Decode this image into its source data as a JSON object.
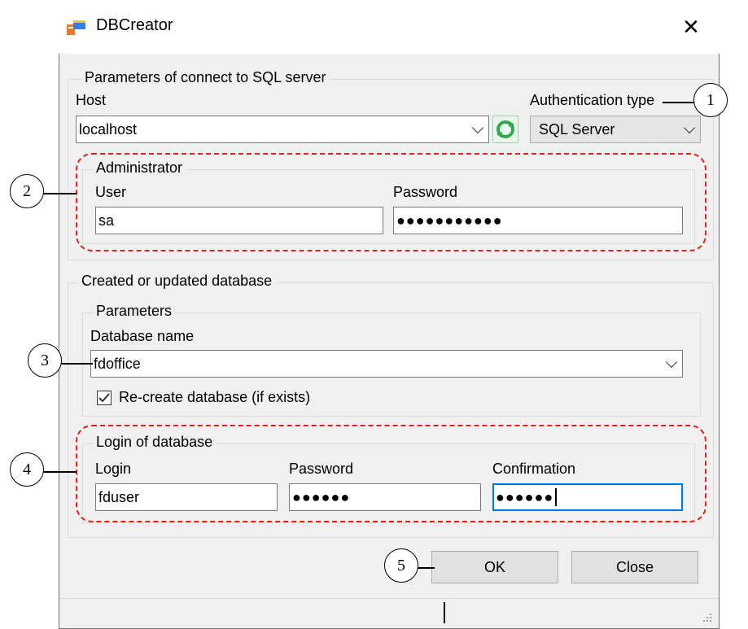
{
  "window": {
    "title": "DBCreator",
    "icon": "app-database-icon"
  },
  "connection": {
    "group_label": "Parameters of connect to SQL server",
    "host_label": "Host",
    "host_value": "localhost",
    "auth_label": "Authentication type",
    "auth_value": "SQL Server",
    "refresh_icon": "refresh-icon",
    "admin": {
      "group_label": "Administrator",
      "user_label": "User",
      "user_value": "sa",
      "password_label": "Password",
      "password_value": "●●●●●●●●●●●"
    }
  },
  "database": {
    "group_label": "Created or updated database",
    "params": {
      "group_label": "Parameters",
      "name_label": "Database name",
      "name_value": "fdoffice",
      "recreate_label": "Re-create database (if exists)",
      "recreate_checked": true
    },
    "login": {
      "group_label": "Login of database",
      "login_label": "Login",
      "login_value": "fduser",
      "password_label": "Password",
      "password_value": "●●●●●●",
      "confirm_label": "Confirmation",
      "confirm_value": "●●●●●●"
    }
  },
  "buttons": {
    "ok": "OK",
    "close": "Close"
  },
  "callouts": [
    "1",
    "2",
    "3",
    "4",
    "5"
  ],
  "colors": {
    "accent": "#0078d7",
    "callout_highlight": "#d9231b",
    "refresh_icon": "#2fa84f"
  }
}
